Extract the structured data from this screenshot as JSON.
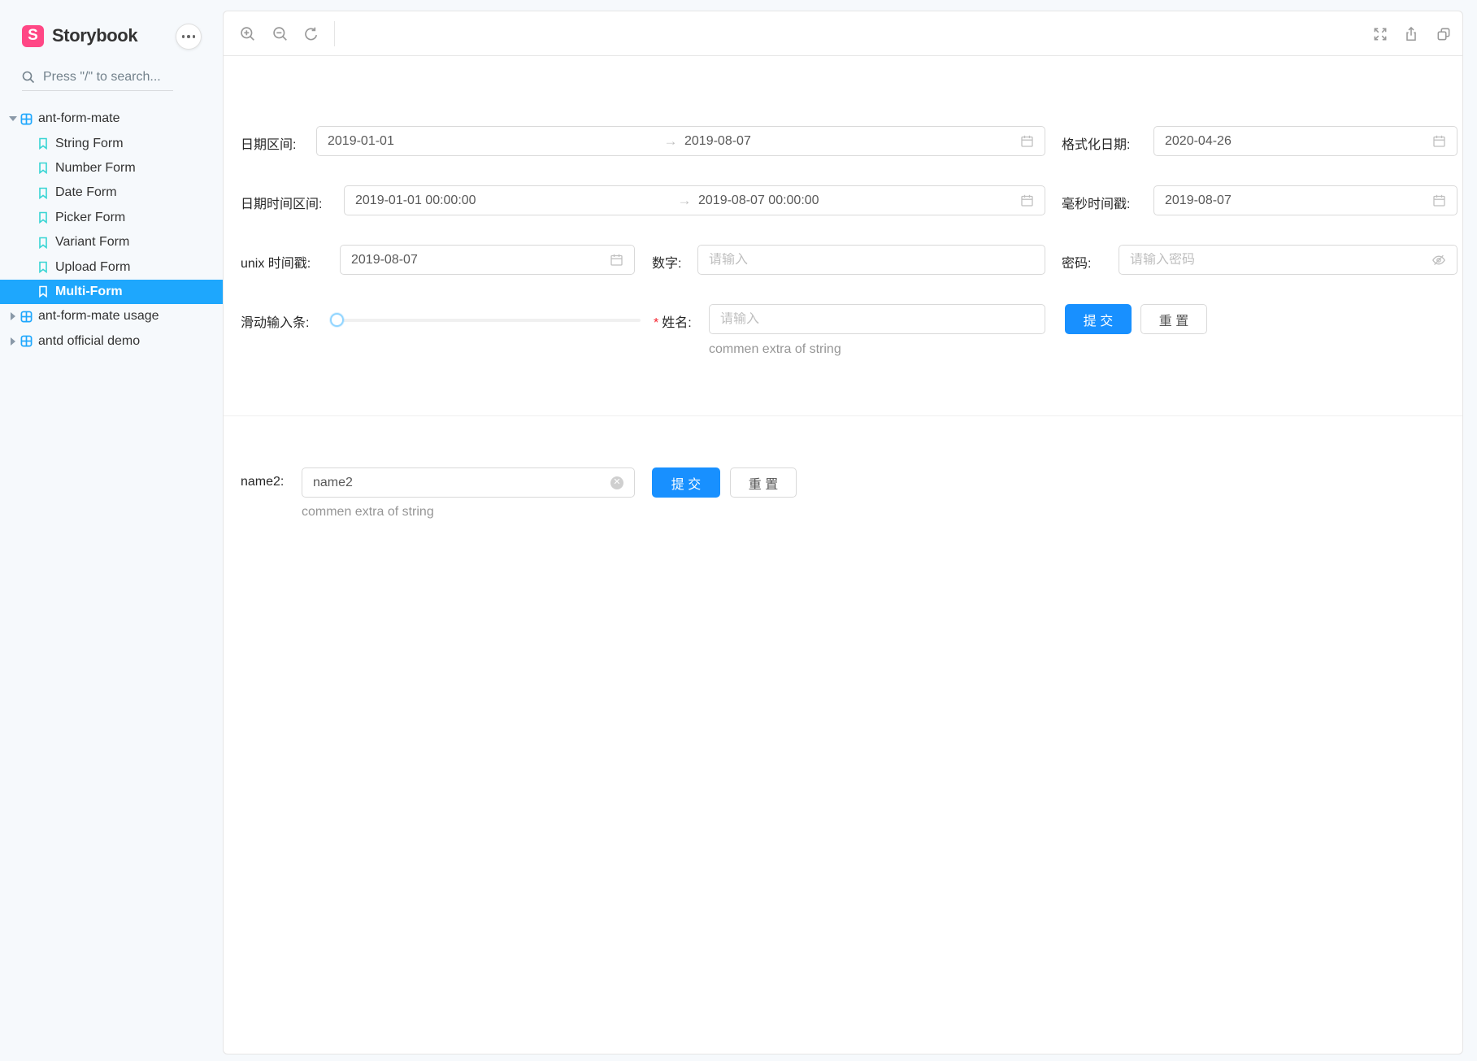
{
  "colors": {
    "brand_pink": "#FF4785",
    "accent_blue": "#1EA7FD",
    "story_icon_teal": "#37D5D3",
    "primary_button_blue": "#1890FF",
    "input_border": "#D9D9D9",
    "placeholder_gray": "#BFBFBF"
  },
  "sidebar": {
    "brand": "Storybook",
    "logo_letter": "S",
    "search": {
      "placeholder": "Press \"/\" to search..."
    },
    "tree": {
      "root": {
        "label": "ant-form-mate",
        "expanded": true
      },
      "stories": [
        {
          "label": "String Form",
          "selected": false
        },
        {
          "label": "Number Form",
          "selected": false
        },
        {
          "label": "Date Form",
          "selected": false
        },
        {
          "label": "Picker Form",
          "selected": false
        },
        {
          "label": "Variant Form",
          "selected": false
        },
        {
          "label": "Upload Form",
          "selected": false
        },
        {
          "label": "Multi-Form",
          "selected": true
        }
      ],
      "collapsed": [
        {
          "label": "ant-form-mate usage"
        },
        {
          "label": "antd official demo"
        }
      ]
    }
  },
  "toolbar": {
    "left_icons": [
      "zoom-in-icon",
      "zoom-out-icon",
      "reset-zoom-icon"
    ],
    "right_icons": [
      "fullscreen-icon",
      "share-icon",
      "copy-link-icon"
    ]
  },
  "preview": {
    "form1": {
      "date_range": {
        "label": "日期区间:",
        "start": "2019-01-01",
        "separator": "→",
        "end": "2019-08-07"
      },
      "formatted_date": {
        "label": "格式化日期:",
        "value": "2020-04-26"
      },
      "datetime_range": {
        "label": "日期时间区间:",
        "start": "2019-01-01 00:00:00",
        "separator": "→",
        "end": "2019-08-07 00:00:00"
      },
      "ms_timestamp": {
        "label": "毫秒时间戳:",
        "value": "2019-08-07"
      },
      "unix_timestamp": {
        "label": "unix 时间戳:",
        "value": "2019-08-07"
      },
      "number": {
        "label": "数字:",
        "placeholder": "请输入"
      },
      "password": {
        "label": "密码:",
        "placeholder": "请输入密码"
      },
      "slider": {
        "label": "滑动输入条:",
        "value": 0
      },
      "name": {
        "label": "姓名:",
        "required_mark": "*",
        "placeholder": "请输入",
        "extra": "commen extra of string"
      },
      "submit_label": "提 交",
      "reset_label": "重 置"
    },
    "form2": {
      "name2": {
        "label": "name2:",
        "value": "name2",
        "extra": "commen extra of string"
      },
      "submit_label": "提 交",
      "reset_label": "重 置"
    }
  }
}
